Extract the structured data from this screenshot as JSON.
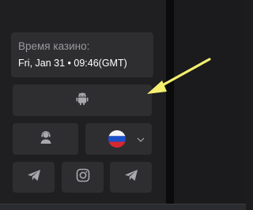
{
  "casino_time": {
    "label": "Время казино:",
    "value": "Fri, Jan 31 • 09:46(GMT)"
  },
  "buttons": {
    "android": {
      "icon": "android-icon"
    },
    "support": {
      "icon": "support-agent-icon"
    },
    "language": {
      "icon": "russia-flag-icon",
      "dropdown_icon": "chevron-down-icon"
    }
  },
  "social": [
    {
      "icon": "telegram-icon"
    },
    {
      "icon": "instagram-icon"
    },
    {
      "icon": "telegram-icon"
    }
  ],
  "annotation": {
    "icon": "arrow-icon",
    "color": "#f4ef6f"
  },
  "colors": {
    "panel": "#1f1f21",
    "card": "#2e2e31",
    "icon": "#a8a8ad",
    "text_muted": "#9a9a9e",
    "text": "#ffffff"
  }
}
